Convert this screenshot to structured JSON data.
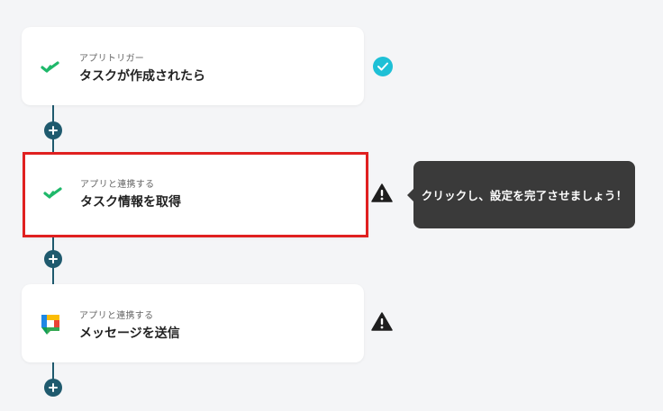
{
  "steps": [
    {
      "sub": "アプリトリガー",
      "title": "タスクが作成されたら",
      "icon": "check-logo-icon",
      "status": "complete"
    },
    {
      "sub": "アプリと連携する",
      "title": "タスク情報を取得",
      "icon": "check-logo-icon",
      "status": "warning"
    },
    {
      "sub": "アプリと連携する",
      "title": "メッセージを送信",
      "icon": "google-chat-icon",
      "status": "warning"
    }
  ],
  "tooltip": {
    "text": "クリックし、設定を完了させましょう！"
  },
  "colors": {
    "accent": "#1f5a6e",
    "complete": "#1ec0d6",
    "highlight": "#e02020"
  }
}
